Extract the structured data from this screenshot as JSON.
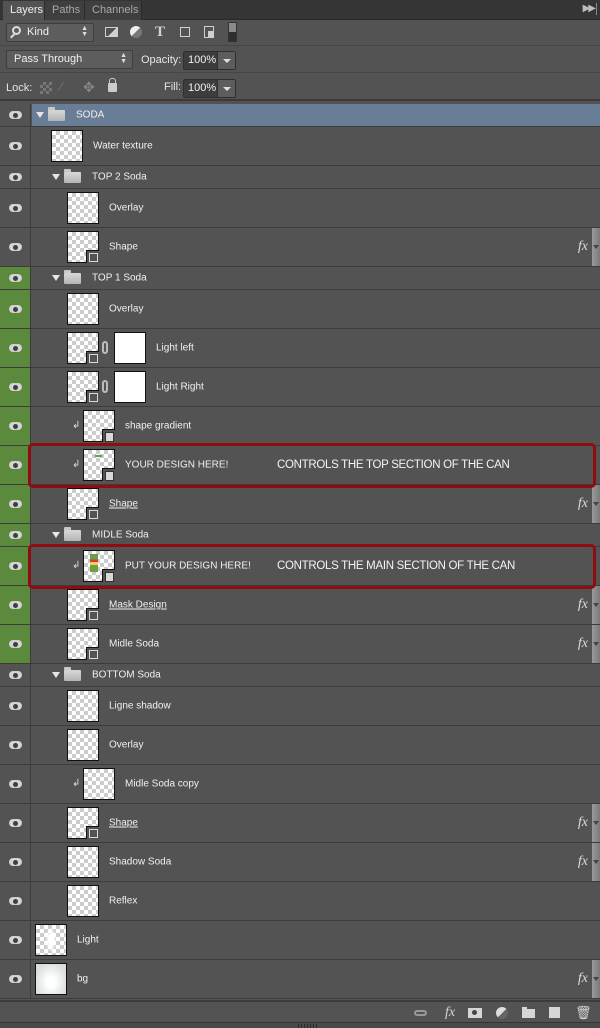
{
  "tabs": [
    {
      "label": "Layers",
      "active": true
    },
    {
      "label": "Paths",
      "active": false
    },
    {
      "label": "Channels",
      "active": false
    }
  ],
  "panel_menu_icon": "double-chevron-right-icon",
  "filter": {
    "kind_label": "Kind",
    "icons": [
      "pixel-layer-filter-icon",
      "adjustment-layer-filter-icon",
      "type-layer-filter-icon",
      "shape-layer-filter-icon",
      "smart-object-filter-icon",
      "filter-toggle-switch"
    ]
  },
  "blend": {
    "mode": "Pass Through",
    "opacity_label": "Opacity:",
    "opacity_value": "100%"
  },
  "lock": {
    "label": "Lock:",
    "icons": [
      "lock-transparent-pixels-icon",
      "lock-image-pixels-icon",
      "lock-position-icon",
      "lock-all-icon"
    ],
    "fill_label": "Fill:",
    "fill_value": "100%"
  },
  "layers": [
    {
      "name": "SODA",
      "type": "group",
      "indent": 0,
      "selected": true,
      "color_tag": "none"
    },
    {
      "name": "Water texture",
      "type": "pixel",
      "indent": 1,
      "color_tag": "none"
    },
    {
      "name": "TOP 2 Soda",
      "type": "group",
      "indent": 1,
      "color_tag": "none"
    },
    {
      "name": "Overlay",
      "type": "pixel",
      "indent": 2,
      "color_tag": "none"
    },
    {
      "name": "Shape",
      "type": "shape",
      "indent": 2,
      "fx": true,
      "color_tag": "none"
    },
    {
      "name": "TOP 1 Soda",
      "type": "group",
      "indent": 1,
      "color_tag": "green"
    },
    {
      "name": "Overlay",
      "type": "pixel",
      "indent": 2,
      "color_tag": "green"
    },
    {
      "name": "Light left",
      "type": "shape-with-mask",
      "indent": 2,
      "color_tag": "green"
    },
    {
      "name": "Light Right",
      "type": "shape-with-mask",
      "indent": 2,
      "color_tag": "green"
    },
    {
      "name": "shape gradient",
      "type": "smart-object",
      "indent": 3,
      "clipped": true,
      "color_tag": "green"
    },
    {
      "name": "YOUR DESIGN HERE!",
      "type": "smart-object",
      "indent": 3,
      "clipped": true,
      "color_tag": "green",
      "annotation": "CONTROLS THE TOP SECTION OF THE CAN"
    },
    {
      "name": "Shape",
      "type": "shape",
      "indent": 2,
      "fx": true,
      "underlined": true,
      "color_tag": "green"
    },
    {
      "name": "MIDLE Soda",
      "type": "group",
      "indent": 1,
      "color_tag": "green"
    },
    {
      "name": "PUT YOUR DESIGN HERE!",
      "type": "smart-object",
      "indent": 3,
      "clipped": true,
      "color_tag": "green",
      "annotation": "CONTROLS THE MAIN SECTION OF THE CAN"
    },
    {
      "name": "Mask Design",
      "type": "shape",
      "indent": 2,
      "fx": true,
      "underlined": true,
      "color_tag": "green"
    },
    {
      "name": "Midle Soda",
      "type": "shape",
      "indent": 2,
      "fx": true,
      "color_tag": "green"
    },
    {
      "name": "BOTTOM Soda",
      "type": "group",
      "indent": 1,
      "color_tag": "none"
    },
    {
      "name": "Ligne shadow",
      "type": "pixel",
      "indent": 2,
      "color_tag": "none"
    },
    {
      "name": "Overlay",
      "type": "pixel",
      "indent": 2,
      "color_tag": "none"
    },
    {
      "name": "Midle Soda copy",
      "type": "pixel",
      "indent": 3,
      "clipped": true,
      "color_tag": "none"
    },
    {
      "name": "Shape",
      "type": "shape",
      "indent": 2,
      "fx": true,
      "underlined": true,
      "color_tag": "none"
    },
    {
      "name": "Shadow Soda",
      "type": "pixel",
      "indent": 2,
      "fx": true,
      "color_tag": "none"
    },
    {
      "name": "Reflex",
      "type": "pixel",
      "indent": 2,
      "color_tag": "none"
    },
    {
      "name": "Light",
      "type": "pixel",
      "indent": 0,
      "color_tag": "none"
    },
    {
      "name": "bg",
      "type": "pixel",
      "indent": 0,
      "fx": true,
      "color_tag": "none"
    }
  ],
  "footer_icons": [
    "link-layers-icon",
    "add-layer-style-icon",
    "add-mask-icon",
    "new-adjustment-layer-icon",
    "new-group-icon",
    "new-layer-icon",
    "delete-layer-icon"
  ],
  "colors": {
    "panel_bg": "#535353",
    "selected_row": "#6a7d97",
    "green_tag": "#5c8a3c",
    "annotation_box": "#8e0d10"
  }
}
